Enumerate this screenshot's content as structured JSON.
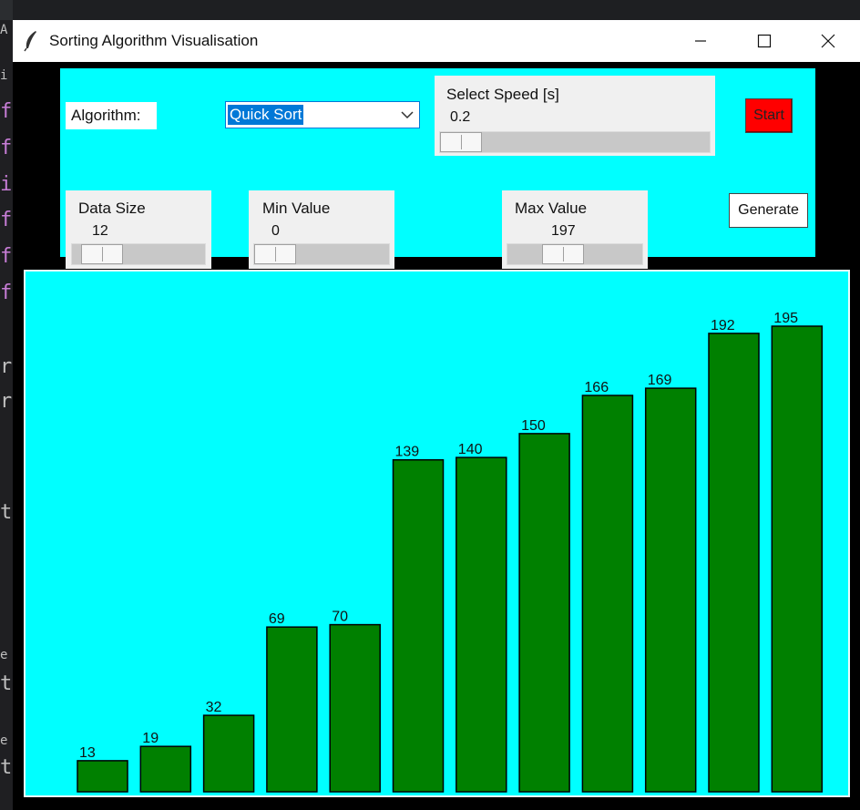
{
  "window": {
    "title": "Sorting Algorithm Visualisation"
  },
  "controls": {
    "algorithm_label": "Algorithm:",
    "algorithm_value": "Quick Sort",
    "speed": {
      "label": "Select Speed [s]",
      "value": "0.2",
      "level": 0.2
    },
    "data_size": {
      "label": "Data Size",
      "value": "12",
      "level": 0.12
    },
    "min_value": {
      "label": "Min Value",
      "value": "0",
      "level": 0.0
    },
    "max_value": {
      "label": "Max Value",
      "value": "197",
      "level": 0.5
    },
    "start_label": "Start",
    "generate_label": "Generate",
    "start_color": "#ff0000",
    "panel_color": "#00ffff"
  },
  "chart_data": {
    "type": "bar",
    "values": [
      13,
      19,
      32,
      69,
      70,
      139,
      140,
      150,
      166,
      169,
      192,
      195
    ],
    "bar_color": "#008000",
    "background": "#00ffff"
  }
}
